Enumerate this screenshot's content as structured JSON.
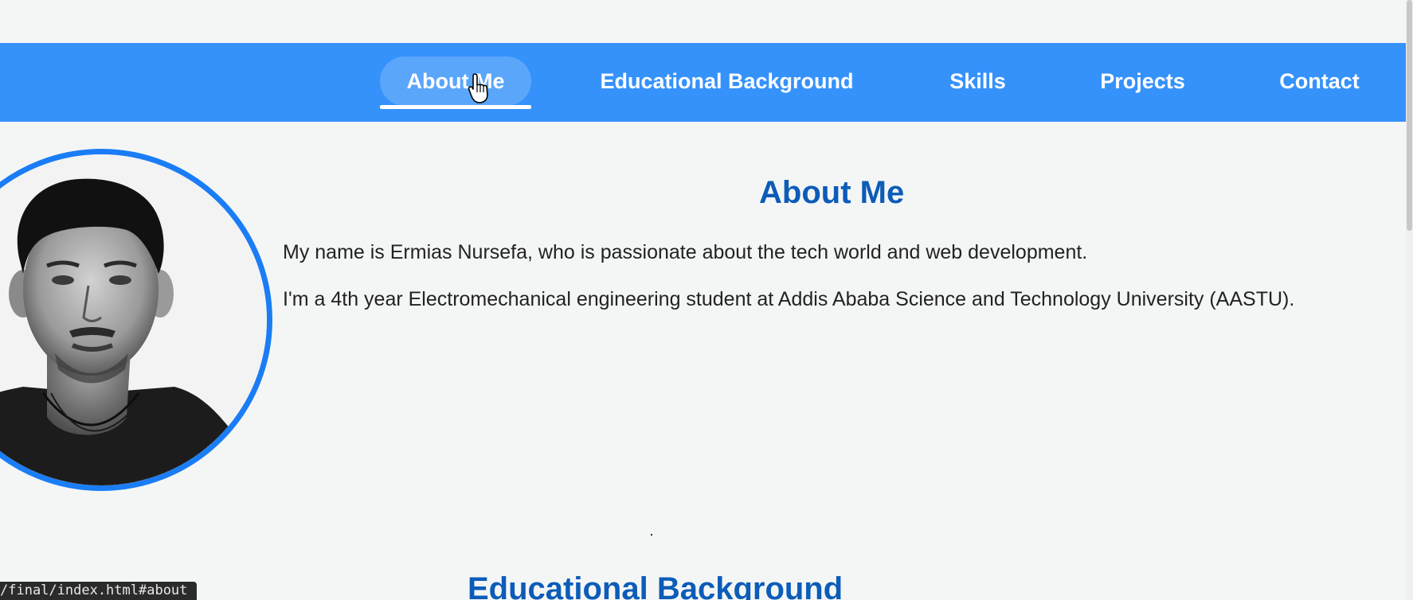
{
  "nav": {
    "items": [
      {
        "label": "About Me",
        "active": true
      },
      {
        "label": "Educational Background",
        "active": false
      },
      {
        "label": "Skills",
        "active": false
      },
      {
        "label": "Projects",
        "active": false
      },
      {
        "label": "Contact",
        "active": false
      }
    ]
  },
  "about": {
    "title": "About Me",
    "paragraph1": "My name is Ermias Nursefa, who is passionate about the tech world and web development.",
    "paragraph2": "I'm a 4th year Electromechanical engineering student at Addis Ababa Science and Technology University (AASTU).",
    "photo_alt": "Profile photo of Ermias Nursefa"
  },
  "education": {
    "title": "Educational Background"
  },
  "status_bar": {
    "url": "/final/index.html#about"
  },
  "colors": {
    "nav_background": "#3592fb",
    "active_pill": "#5aa6fb",
    "heading": "#0c5cb8",
    "avatar_border": "#1a7df5",
    "page_background": "#f4f6f6"
  }
}
